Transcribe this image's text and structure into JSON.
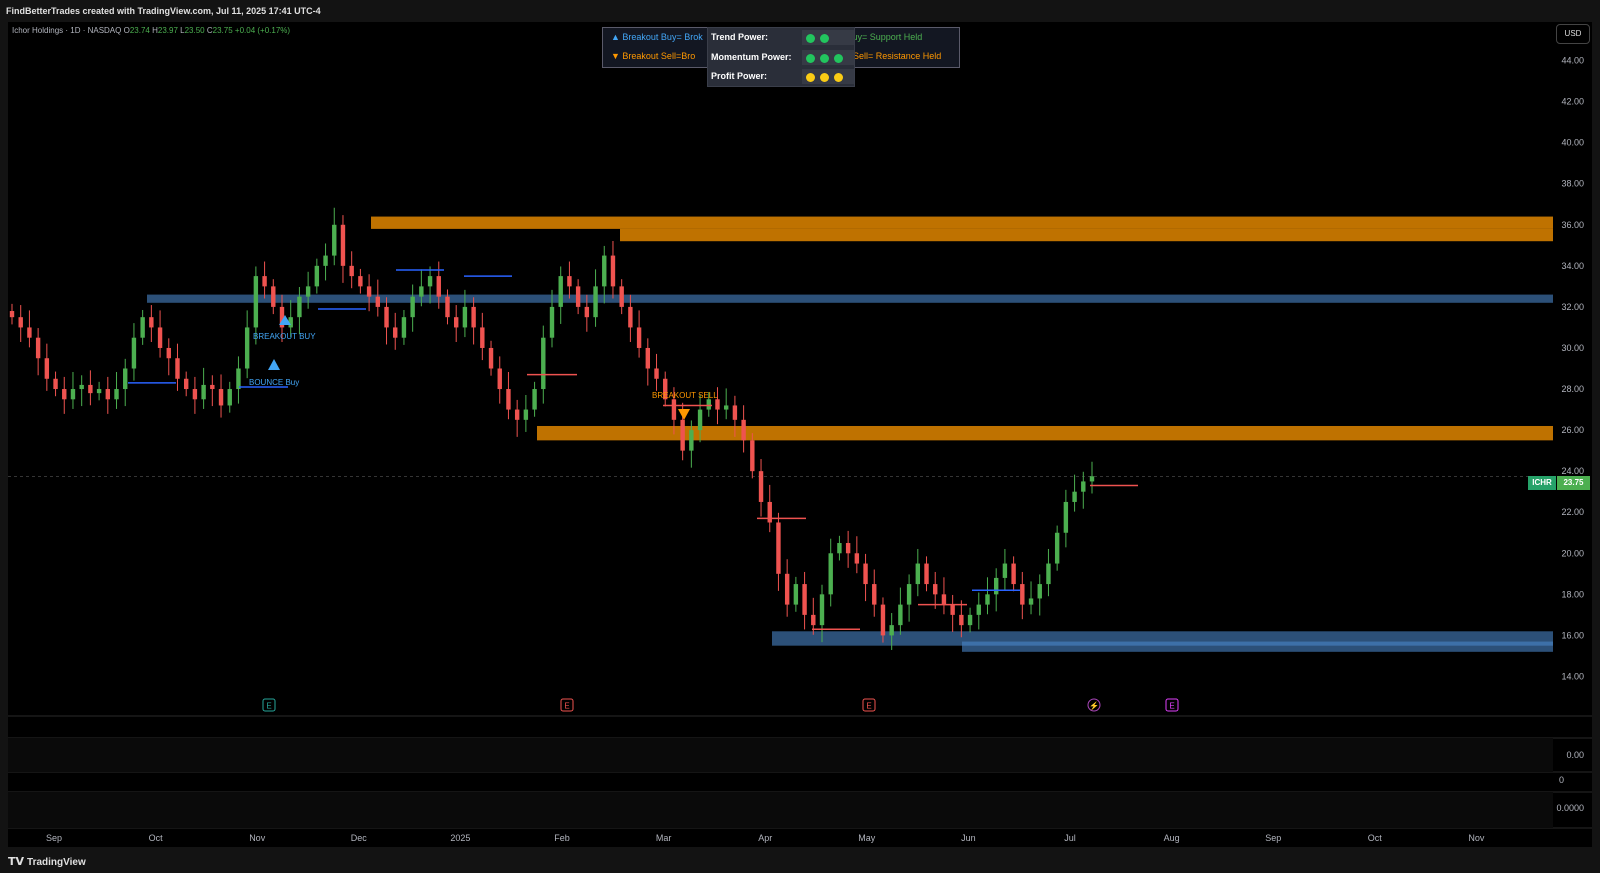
{
  "header": {
    "attribution": "FindBetterTrades created with TradingView.com, Jul 11, 2025 17:41 UTC-4"
  },
  "symbol": {
    "name_line": "Ichor Holdings · 1D · NASDAQ",
    "o_label": "O",
    "o": "23.74",
    "h_label": "H",
    "h": "23.97",
    "l_label": "L",
    "l": "23.50",
    "c_label": "C",
    "c": "23.75",
    "change": "+0.04 (+0.17%)",
    "ticker": "ICHR",
    "last_price": "23.75",
    "currency": "USD"
  },
  "legend": {
    "row1_left": "▲ Breakout Buy= Brok",
    "row1_right": "e Buy= Support Held",
    "row2_left": "▼ Breakout Sell=Bro",
    "row2_right": "Sell= Resistance Held"
  },
  "power_table": [
    {
      "label": "Trend Power:",
      "dots": [
        "#22c55e",
        "#22c55e"
      ]
    },
    {
      "label": "Momentum Power:",
      "dots": [
        "#22c55e",
        "#22c55e",
        "#22c55e"
      ]
    },
    {
      "label": "Profit Power:",
      "dots": [
        "#facc15",
        "#facc15",
        "#facc15"
      ]
    }
  ],
  "annotations": {
    "breakout_buy": "BREAKOUT BUY",
    "bounce_buy": "BOUNCE Buy",
    "breakout_sell": "BREAKOUT SELL"
  },
  "earnings_markers": [
    {
      "label": "E",
      "color": "#26a69a"
    },
    {
      "label": "E",
      "color": "#ef5350"
    },
    {
      "label": "E",
      "color": "#ef5350"
    },
    {
      "label": "⚡",
      "color": "#ab47bc"
    },
    {
      "label": "E",
      "color": "#e040fb"
    }
  ],
  "subpanes": {
    "pane1_value": "0.00",
    "pane2_value": "0",
    "pane3_value": "0.0000"
  },
  "footer": {
    "logo_text": "TradingView"
  },
  "chart_data": {
    "type": "candlestick",
    "x_ticks": [
      "Sep",
      "Oct",
      "Nov",
      "Dec",
      "2025",
      "Feb",
      "Mar",
      "Apr",
      "May",
      "Jun",
      "Jul",
      "Aug",
      "Sep",
      "Oct",
      "Nov"
    ],
    "y_ticks": [
      "44.00",
      "42.00",
      "40.00",
      "38.00",
      "36.00",
      "34.00",
      "32.00",
      "30.00",
      "28.00",
      "26.00",
      "24.00",
      "22.00",
      "20.00",
      "18.00",
      "16.00",
      "14.00"
    ],
    "ylim": [
      13,
      45
    ],
    "colors": {
      "up": "#4caf50",
      "down": "#ef5350",
      "resistance_zone": "#ff9800",
      "support_zone": "#42a5f5"
    },
    "closes_approx": [
      31.5,
      31.0,
      30.5,
      29.5,
      28.5,
      28.0,
      27.5,
      28.0,
      28.2,
      27.8,
      28.0,
      27.5,
      28.0,
      29.0,
      30.5,
      31.5,
      31.0,
      30.0,
      29.5,
      28.5,
      28.0,
      27.5,
      28.2,
      28.0,
      27.2,
      28.0,
      29.0,
      31.0,
      33.5,
      33.0,
      32.0,
      31.0,
      31.5,
      32.5,
      33.0,
      34.0,
      34.5,
      36.0,
      34.0,
      33.5,
      33.0,
      32.5,
      32.0,
      31.0,
      30.5,
      31.5,
      32.5,
      33.0,
      33.5,
      32.5,
      31.5,
      31.0,
      32.0,
      31.0,
      30.0,
      29.0,
      28.0,
      27.0,
      26.5,
      27.0,
      28.0,
      30.5,
      32.0,
      33.5,
      33.0,
      32.0,
      31.5,
      33.0,
      34.5,
      33.0,
      32.0,
      31.0,
      30.0,
      29.0,
      28.5,
      27.5,
      26.5,
      25.0,
      26.0,
      27.0,
      27.5,
      27.0,
      27.2,
      26.5,
      25.5,
      24.0,
      22.5,
      21.5,
      19.0,
      17.5,
      18.5,
      17.0,
      16.5,
      18.0,
      20.0,
      20.5,
      20.0,
      19.5,
      18.5,
      17.5,
      16.0,
      16.5,
      17.5,
      18.5,
      19.5,
      18.5,
      18.0,
      17.5,
      17.0,
      16.5,
      17.0,
      17.5,
      18.0,
      18.8,
      19.5,
      18.5,
      17.5,
      17.8,
      18.5,
      19.5,
      21.0,
      22.5,
      23.0,
      23.5,
      23.75
    ],
    "zones": [
      {
        "kind": "resistance",
        "low": 35.8,
        "high": 36.4
      },
      {
        "kind": "resistance",
        "low": 35.2,
        "high": 35.8
      },
      {
        "kind": "support",
        "low": 32.2,
        "high": 32.6
      },
      {
        "kind": "resistance",
        "low": 25.5,
        "high": 26.2
      },
      {
        "kind": "support",
        "low": 15.5,
        "high": 16.2
      },
      {
        "kind": "support",
        "low": 15.2,
        "high": 15.7
      }
    ]
  }
}
